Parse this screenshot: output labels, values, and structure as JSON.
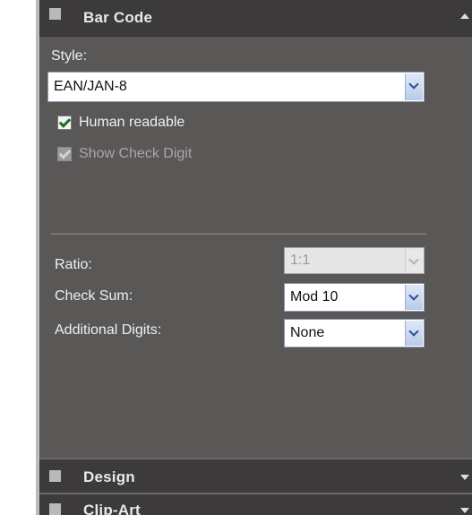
{
  "sections": {
    "bar_code": {
      "title": "Bar Code",
      "expanded": true
    },
    "design": {
      "title": "Design",
      "expanded": false
    },
    "clip_art": {
      "title": "Clip-Art",
      "expanded": false
    }
  },
  "style": {
    "label": "Style:",
    "value": "EAN/JAN-8"
  },
  "human_readable": {
    "label": "Human readable",
    "checked": true,
    "enabled": true
  },
  "show_check_digit": {
    "label": "Show Check Digit",
    "checked": true,
    "enabled": false
  },
  "ratio": {
    "label": "Ratio:",
    "value": "1:1",
    "enabled": false
  },
  "check_sum": {
    "label": "Check Sum:",
    "value": "Mod 10"
  },
  "additional_digits": {
    "label": "Additional Digits:",
    "value": "None"
  },
  "colors": {
    "panel_bg": "#5a5757",
    "header_bg": "#3c3a3a",
    "check_green": "#1d6e1d"
  }
}
